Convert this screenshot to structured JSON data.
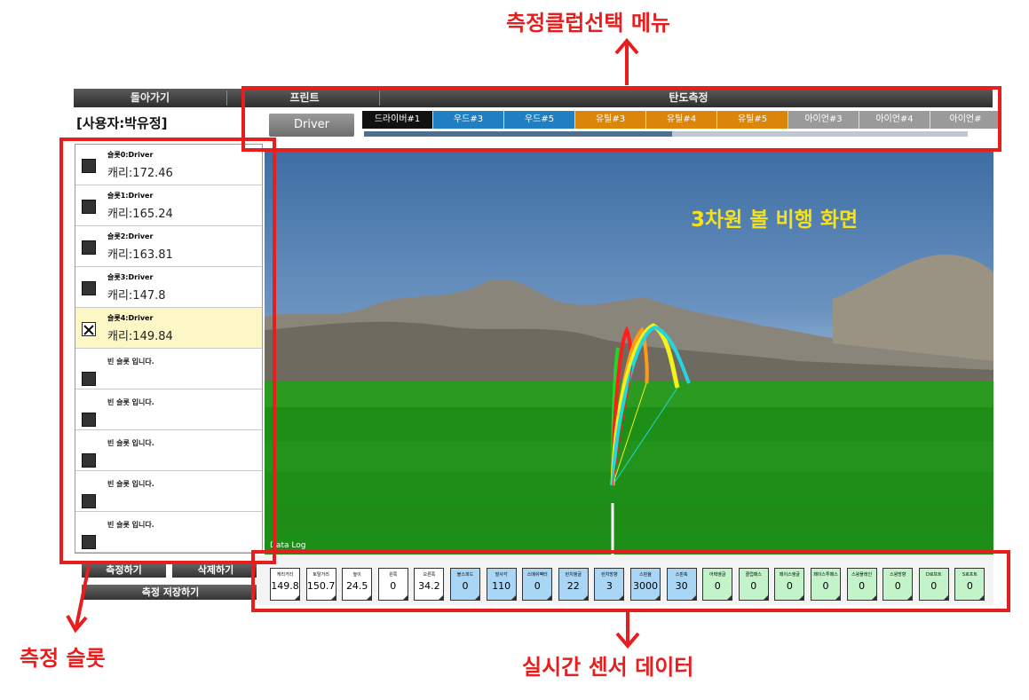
{
  "nav": {
    "back": "돌아가기",
    "print": "프린트",
    "ballistic": "탄도측정"
  },
  "user_label": "[사용자:박유정]",
  "club": {
    "current": "Driver",
    "tabs": [
      {
        "label": "드라이버#1",
        "color": "#111111"
      },
      {
        "label": "우드#3",
        "color": "#1f7fc0"
      },
      {
        "label": "우드#5",
        "color": "#1f7fc0"
      },
      {
        "label": "유틸#3",
        "color": "#d9860b"
      },
      {
        "label": "유틸#4",
        "color": "#d9860b"
      },
      {
        "label": "유틸#5",
        "color": "#d9860b"
      },
      {
        "label": "아이언#3",
        "color": "#9a9a9a"
      },
      {
        "label": "아이언#4",
        "color": "#9a9a9a"
      },
      {
        "label": "아이언#",
        "color": "#9a9a9a"
      }
    ],
    "progress_fraction": 0.51
  },
  "slots": [
    {
      "name": "슬롯0:Driver",
      "carry": "캐리:172.46",
      "selected": false
    },
    {
      "name": "슬롯1:Driver",
      "carry": "캐리:165.24",
      "selected": false
    },
    {
      "name": "슬롯2:Driver",
      "carry": "캐리:163.81",
      "selected": false
    },
    {
      "name": "슬롯3:Driver",
      "carry": "캐리:147.8",
      "selected": false
    },
    {
      "name": "슬롯4:Driver",
      "carry": "캐리:149.84",
      "selected": true
    },
    {
      "empty": "빈 슬롯 입니다."
    },
    {
      "empty": "빈 슬롯 입니다."
    },
    {
      "empty": "빈 슬롯 입니다."
    },
    {
      "empty": "빈 슬롯 입니다."
    },
    {
      "empty": "빈 슬롯 입니다."
    }
  ],
  "buttons": {
    "measure": "측정하기",
    "delete": "삭제하기",
    "save": "측정 저장하기"
  },
  "view": {
    "datalog": "Data Log"
  },
  "sensors": [
    {
      "label": "캐리거리",
      "value": "149.8",
      "kind": "w"
    },
    {
      "label": "토탈거리",
      "value": "150.7",
      "kind": "w"
    },
    {
      "label": "높이",
      "value": "24.5",
      "kind": "w"
    },
    {
      "label": "왼쪽",
      "value": "0",
      "kind": "w"
    },
    {
      "label": "오른쪽",
      "value": "34.2",
      "kind": "w"
    },
    {
      "label": "볼스피드",
      "value": "0",
      "kind": "b"
    },
    {
      "label": "발사각",
      "value": "110",
      "kind": "b"
    },
    {
      "label": "스매쉬팩터",
      "value": "0",
      "kind": "b"
    },
    {
      "label": "런치앵글",
      "value": "22",
      "kind": "b"
    },
    {
      "label": "런치방향",
      "value": "3",
      "kind": "b"
    },
    {
      "label": "스핀율",
      "value": "3000",
      "kind": "b"
    },
    {
      "label": "스핀축",
      "value": "30",
      "kind": "b"
    },
    {
      "label": "어택앵글",
      "value": "0",
      "kind": "g"
    },
    {
      "label": "클럽패스",
      "value": "0",
      "kind": "g"
    },
    {
      "label": "페이스앵글",
      "value": "0",
      "kind": "g"
    },
    {
      "label": "페이스투패스",
      "value": "0",
      "kind": "g"
    },
    {
      "label": "스윙플레인",
      "value": "0",
      "kind": "g"
    },
    {
      "label": "스윙방향",
      "value": "0",
      "kind": "g"
    },
    {
      "label": "D로프트",
      "value": "0",
      "kind": "g"
    },
    {
      "label": "S로프트",
      "value": "0",
      "kind": "g"
    }
  ],
  "annotations": {
    "club_menu": "측정클럽선택 메뉴",
    "view3d": "3차원 볼 비행 화면",
    "slots": "측정 슬롯",
    "sensor": "실시간 센서 데이터"
  },
  "colors": {
    "annotation_red": "#e61e1e",
    "annotation_yellow": "#f7e11b",
    "selected_slot": "#fcf7c4"
  }
}
